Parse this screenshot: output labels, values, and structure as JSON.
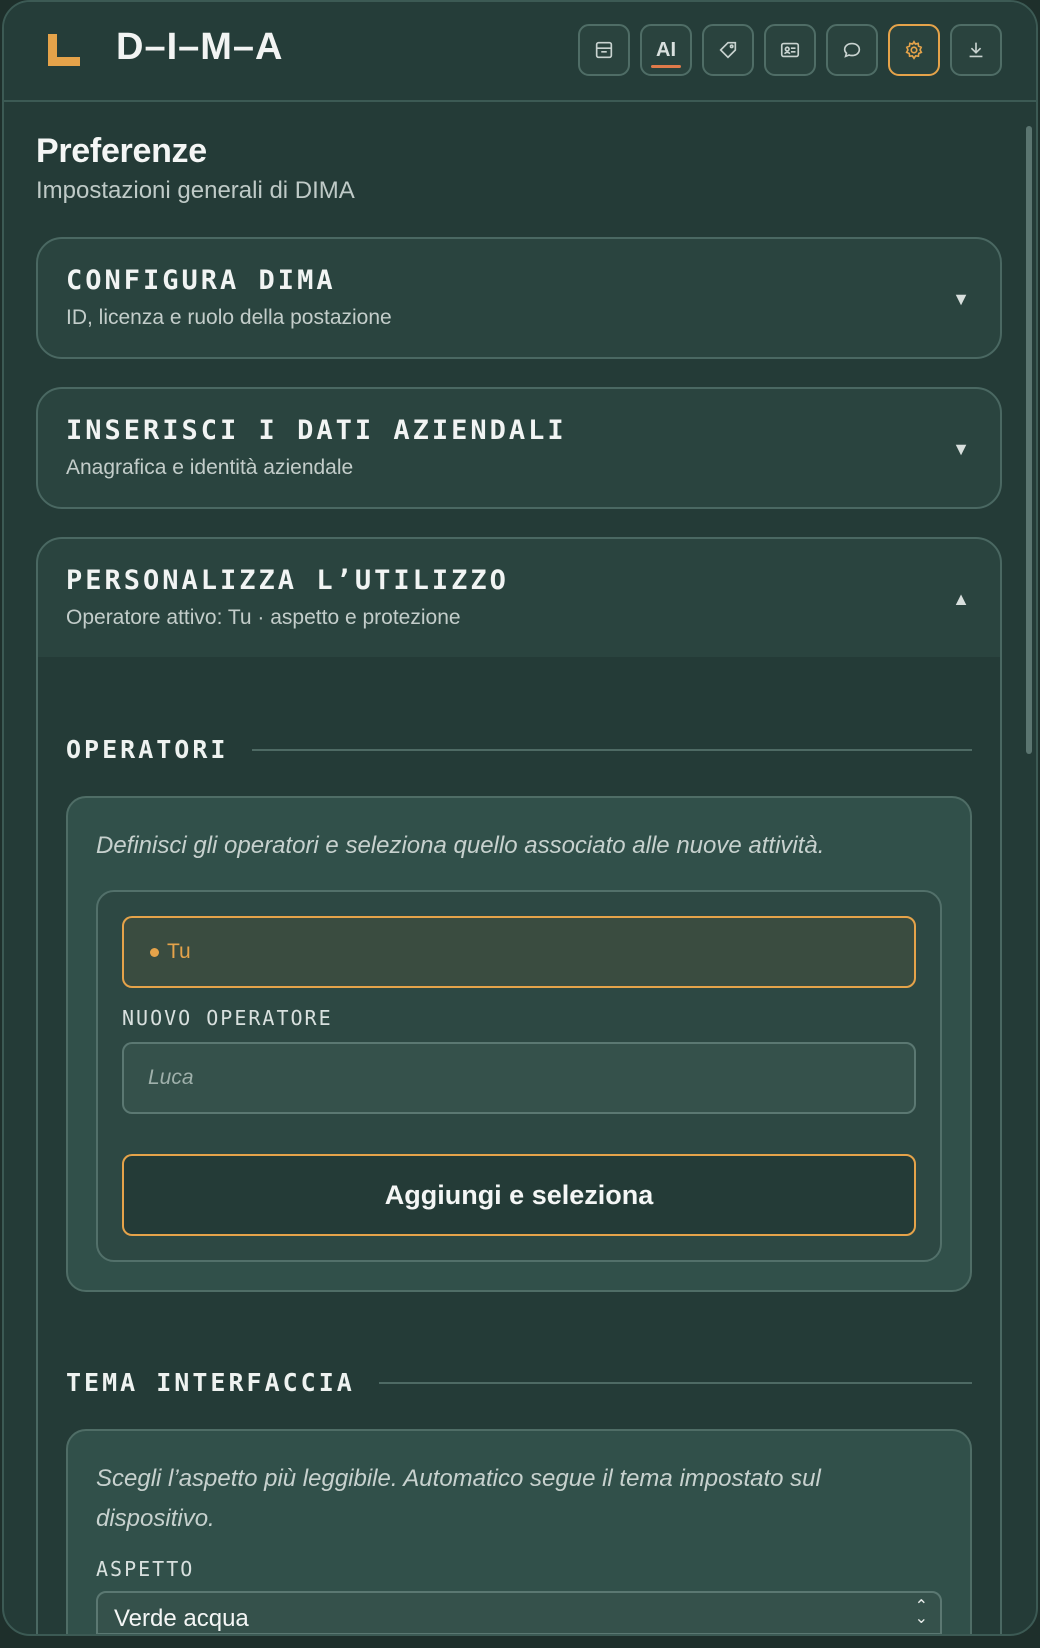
{
  "app": {
    "title": "D–I–M–A"
  },
  "toolbar": {
    "buttons": [
      {
        "icon": "archive-icon"
      },
      {
        "icon": "ai-icon",
        "label": "AI"
      },
      {
        "icon": "tag-icon"
      },
      {
        "icon": "id-card-icon"
      },
      {
        "icon": "chat-icon"
      },
      {
        "icon": "gear-icon",
        "active": true
      },
      {
        "icon": "download-icon"
      }
    ]
  },
  "page": {
    "title": "Preferenze",
    "subtitle": "Impostazioni generali di DIMA"
  },
  "sections": {
    "configura": {
      "title": "CONFIGURA DIMA",
      "subtitle": "ID, licenza e ruolo della postazione",
      "caret": "▼"
    },
    "dati": {
      "title": "INSERISCI I DATI AZIENDALI",
      "subtitle": "Anagrafica e identità aziendale",
      "caret": "▼"
    },
    "personalizza": {
      "title": "PERSONALIZZA L’UTILIZZO",
      "subtitle": "Operatore attivo: Tu · aspetto e protezione",
      "caret": "▲"
    }
  },
  "operatori": {
    "heading": "OPERATORI",
    "note": "Definisci gli operatori e seleziona quello associato alle nuove attività.",
    "active_operator": "Tu",
    "new_label": "NUOVO OPERATORE",
    "new_placeholder": "Luca",
    "add_button": "Aggiungi e seleziona"
  },
  "tema": {
    "heading": "TEMA INTERFACCIA",
    "note": "Scegli l’aspetto più leggibile. Automatico segue il tema impostato sul dispositivo.",
    "aspect_label": "ASPETTO",
    "aspect_value": "Verde acqua"
  },
  "colors": {
    "accent": "#e5a34a",
    "background": "#243b37",
    "panel": "#31504a",
    "ai_underline": "#e07a4a"
  }
}
